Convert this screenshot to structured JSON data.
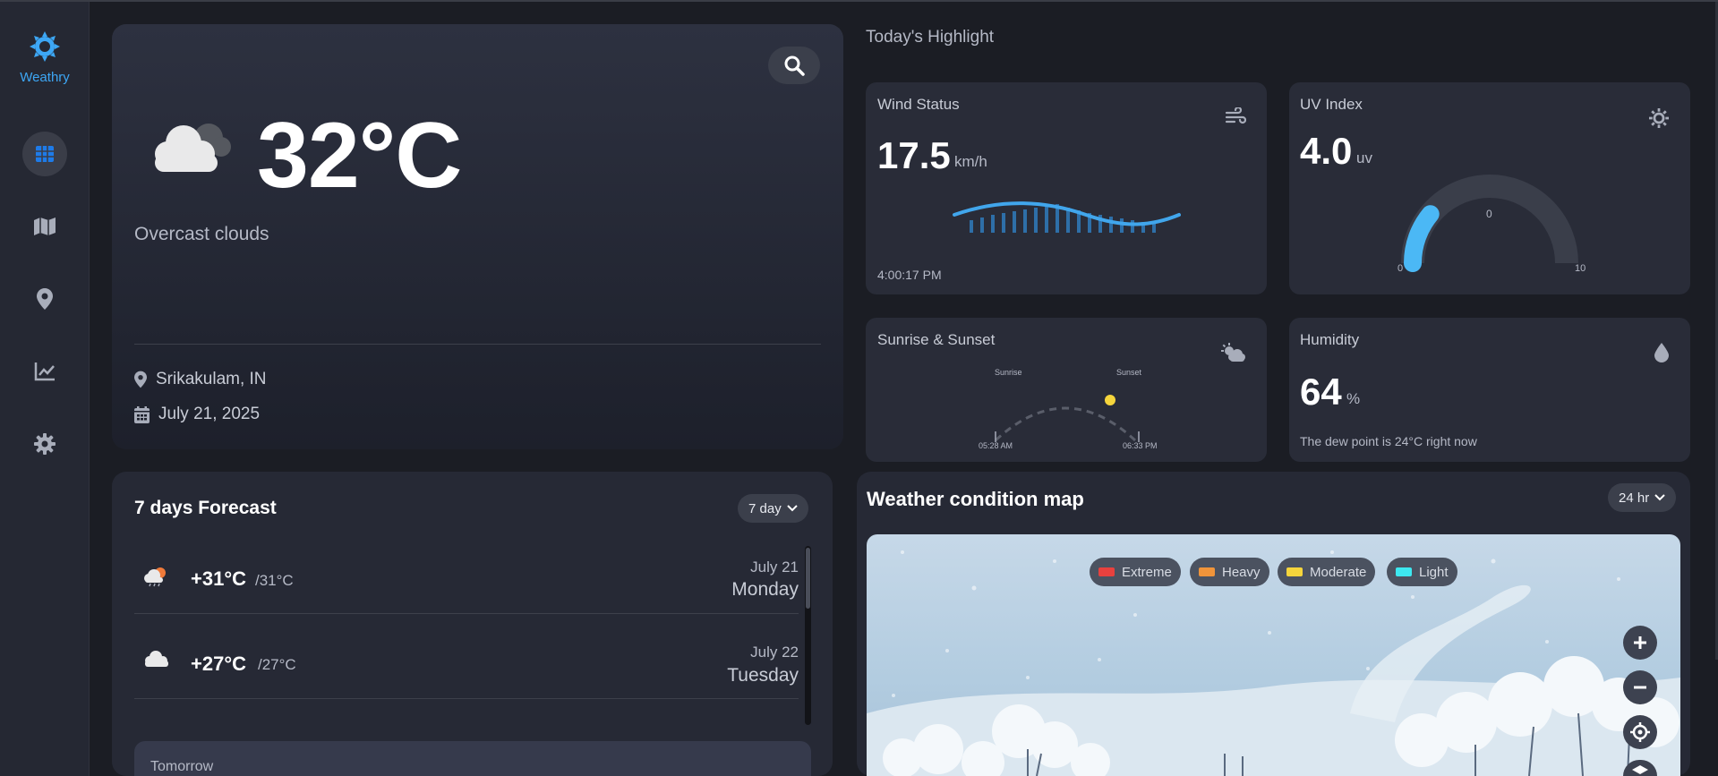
{
  "app": {
    "name": "Weathry",
    "accent": "#3da7f5"
  },
  "sidebar": {
    "items": [
      {
        "icon": "grid-icon",
        "active": true
      },
      {
        "icon": "map-icon",
        "active": false
      },
      {
        "icon": "location-pin-icon",
        "active": false
      },
      {
        "icon": "chart-line-icon",
        "active": false
      },
      {
        "icon": "gear-icon",
        "active": false
      }
    ]
  },
  "current": {
    "temperature": "32°C",
    "description": "Overcast clouds",
    "location": "Srikakulam, IN",
    "date": "July 21, 2025"
  },
  "highlights": {
    "title": "Today's Highlight",
    "wind": {
      "label": "Wind Status",
      "value": "17.5",
      "unit": "km/h",
      "time": "4:00:17 PM"
    },
    "uv": {
      "label": "UV Index",
      "value": "4.0",
      "unit": "uv",
      "gauge_mid": "0",
      "gauge_min": "0",
      "gauge_max": "10",
      "level": 0.4
    },
    "sun": {
      "label": "Sunrise & Sunset",
      "sunrise_label": "Sunrise",
      "sunset_label": "Sunset",
      "sunrise_time": "05:28 AM",
      "sunset_time": "06:33 PM"
    },
    "humidity": {
      "label": "Humidity",
      "value": "64",
      "unit": "%",
      "note": "The dew point is 24°C right now"
    }
  },
  "forecast": {
    "title": "7 days Forecast",
    "range_label": "7 day",
    "days": [
      {
        "icon": "cloud-sun-rain-icon",
        "high": "+31°C",
        "low": "/31°C",
        "date": "July 21",
        "day": "Monday"
      },
      {
        "icon": "cloud-icon",
        "high": "+27°C",
        "low": "/27°C",
        "date": "July 22",
        "day": "Tuesday"
      }
    ],
    "tomorrow_label": "Tomorrow"
  },
  "map": {
    "title": "Weather condition map",
    "range_label": "24 hr",
    "legend": [
      {
        "label": "Extreme",
        "color": "#e8413e"
      },
      {
        "label": "Heavy",
        "color": "#f0943a"
      },
      {
        "label": "Moderate",
        "color": "#f5d53c"
      },
      {
        "label": "Light",
        "color": "#3de8f0"
      }
    ]
  }
}
